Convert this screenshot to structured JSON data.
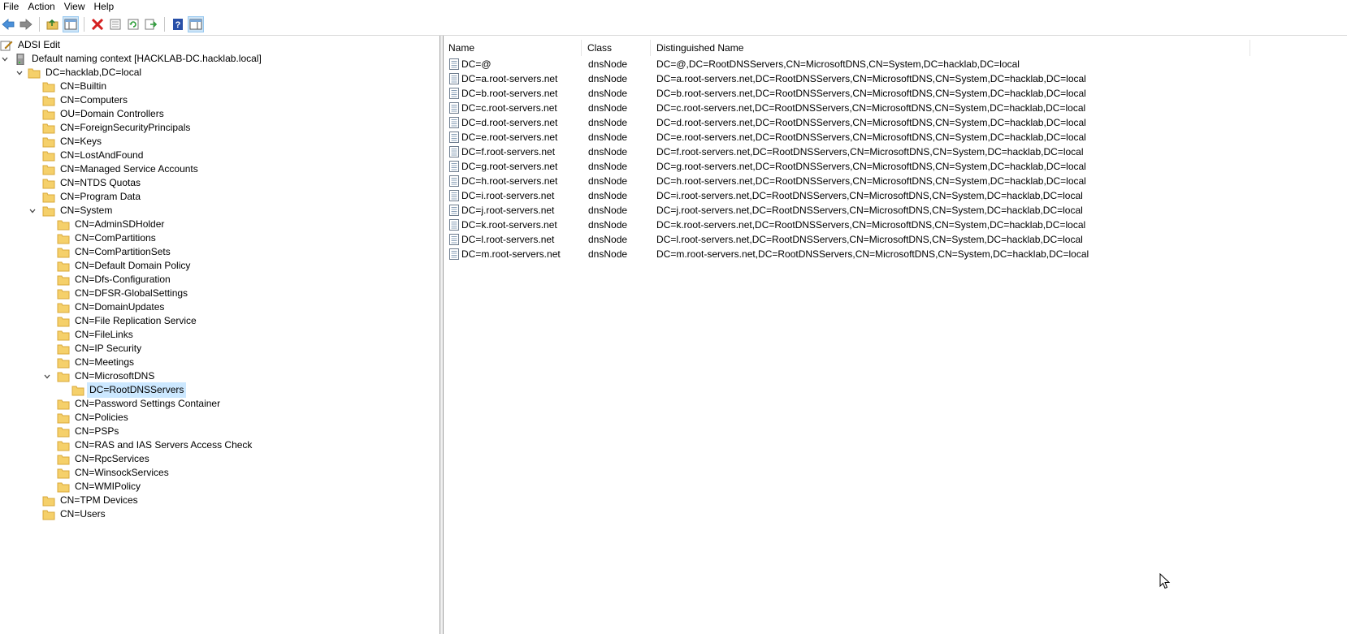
{
  "menu": [
    "File",
    "Action",
    "View",
    "Help"
  ],
  "toolbar": {
    "icons": [
      "back-arrow-icon",
      "forward-arrow-icon",
      "up-folder-icon",
      "show-hide-tree-icon",
      "delete-icon",
      "properties-icon",
      "refresh-icon",
      "export-list-icon",
      "help-icon",
      "show-action-pane-icon"
    ]
  },
  "tree": {
    "root": "ADSI Edit",
    "context": "Default naming context [HACKLAB-DC.hacklab.local]",
    "domain": "DC=hacklab,DC=local",
    "level2": [
      "CN=Builtin",
      "CN=Computers",
      "OU=Domain Controllers",
      "CN=ForeignSecurityPrincipals",
      "CN=Keys",
      "CN=LostAndFound",
      "CN=Managed Service Accounts",
      "CN=NTDS Quotas",
      "CN=Program Data",
      "CN=System"
    ],
    "system_children": [
      "CN=AdminSDHolder",
      "CN=ComPartitions",
      "CN=ComPartitionSets",
      "CN=Default Domain Policy",
      "CN=Dfs-Configuration",
      "CN=DFSR-GlobalSettings",
      "CN=DomainUpdates",
      "CN=File Replication Service",
      "CN=FileLinks",
      "CN=IP Security",
      "CN=Meetings",
      "CN=MicrosoftDNS"
    ],
    "dns_child": "DC=RootDNSServers",
    "system_children_after": [
      "CN=Password Settings Container",
      "CN=Policies",
      "CN=PSPs",
      "CN=RAS and IAS Servers Access Check",
      "CN=RpcServices",
      "CN=WinsockServices",
      "CN=WMIPolicy"
    ],
    "level2_after": [
      "CN=TPM Devices",
      "CN=Users"
    ]
  },
  "list": {
    "headers": {
      "name": "Name",
      "class": "Class",
      "dn": "Distinguished Name"
    },
    "rows": [
      {
        "name": "DC=@",
        "class": "dnsNode",
        "dn": "DC=@,DC=RootDNSServers,CN=MicrosoftDNS,CN=System,DC=hacklab,DC=local"
      },
      {
        "name": "DC=a.root-servers.net",
        "class": "dnsNode",
        "dn": "DC=a.root-servers.net,DC=RootDNSServers,CN=MicrosoftDNS,CN=System,DC=hacklab,DC=local"
      },
      {
        "name": "DC=b.root-servers.net",
        "class": "dnsNode",
        "dn": "DC=b.root-servers.net,DC=RootDNSServers,CN=MicrosoftDNS,CN=System,DC=hacklab,DC=local"
      },
      {
        "name": "DC=c.root-servers.net",
        "class": "dnsNode",
        "dn": "DC=c.root-servers.net,DC=RootDNSServers,CN=MicrosoftDNS,CN=System,DC=hacklab,DC=local"
      },
      {
        "name": "DC=d.root-servers.net",
        "class": "dnsNode",
        "dn": "DC=d.root-servers.net,DC=RootDNSServers,CN=MicrosoftDNS,CN=System,DC=hacklab,DC=local"
      },
      {
        "name": "DC=e.root-servers.net",
        "class": "dnsNode",
        "dn": "DC=e.root-servers.net,DC=RootDNSServers,CN=MicrosoftDNS,CN=System,DC=hacklab,DC=local"
      },
      {
        "name": "DC=f.root-servers.net",
        "class": "dnsNode",
        "dn": "DC=f.root-servers.net,DC=RootDNSServers,CN=MicrosoftDNS,CN=System,DC=hacklab,DC=local"
      },
      {
        "name": "DC=g.root-servers.net",
        "class": "dnsNode",
        "dn": "DC=g.root-servers.net,DC=RootDNSServers,CN=MicrosoftDNS,CN=System,DC=hacklab,DC=local"
      },
      {
        "name": "DC=h.root-servers.net",
        "class": "dnsNode",
        "dn": "DC=h.root-servers.net,DC=RootDNSServers,CN=MicrosoftDNS,CN=System,DC=hacklab,DC=local"
      },
      {
        "name": "DC=i.root-servers.net",
        "class": "dnsNode",
        "dn": "DC=i.root-servers.net,DC=RootDNSServers,CN=MicrosoftDNS,CN=System,DC=hacklab,DC=local"
      },
      {
        "name": "DC=j.root-servers.net",
        "class": "dnsNode",
        "dn": "DC=j.root-servers.net,DC=RootDNSServers,CN=MicrosoftDNS,CN=System,DC=hacklab,DC=local"
      },
      {
        "name": "DC=k.root-servers.net",
        "class": "dnsNode",
        "dn": "DC=k.root-servers.net,DC=RootDNSServers,CN=MicrosoftDNS,CN=System,DC=hacklab,DC=local"
      },
      {
        "name": "DC=l.root-servers.net",
        "class": "dnsNode",
        "dn": "DC=l.root-servers.net,DC=RootDNSServers,CN=MicrosoftDNS,CN=System,DC=hacklab,DC=local"
      },
      {
        "name": "DC=m.root-servers.net",
        "class": "dnsNode",
        "dn": "DC=m.root-servers.net,DC=RootDNSServers,CN=MicrosoftDNS,CN=System,DC=hacklab,DC=local"
      }
    ]
  },
  "colors": {
    "selection": "#cce8ff",
    "folder": "#f5d06a",
    "folder_edge": "#d9a83a",
    "accent": "#0063b1"
  }
}
